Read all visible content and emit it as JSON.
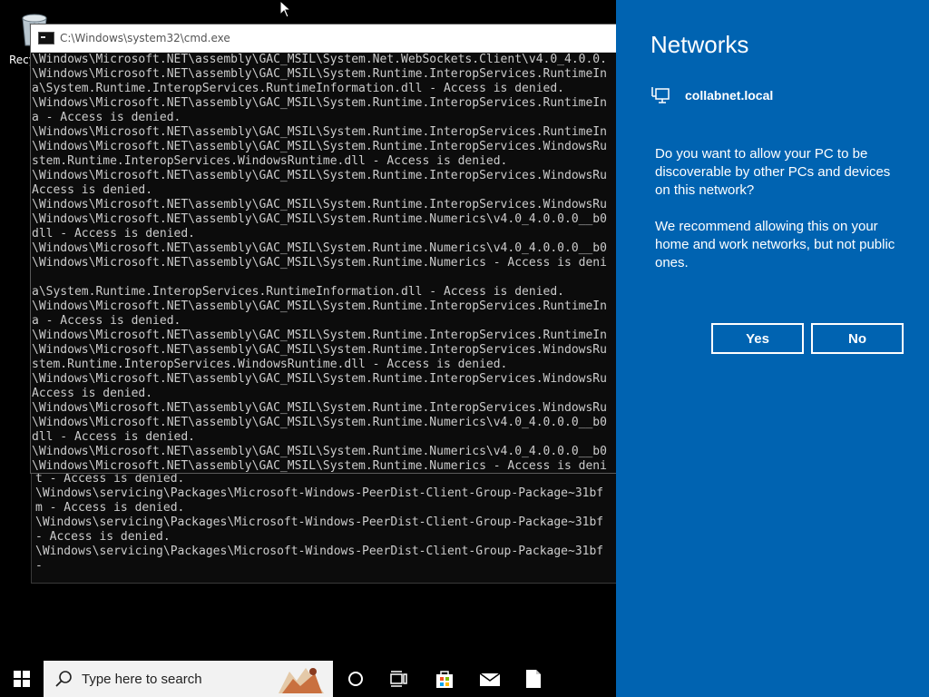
{
  "desktop": {
    "recycle_bin_label": "Recy"
  },
  "cmd_window": {
    "title": "C:\\Windows\\system32\\cmd.exe",
    "lines": [
      "\\Windows\\Microsoft.NET\\assembly\\GAC_MSIL\\System.Net.WebSockets.Client\\v4.0_4.0.0.",
      "\\Windows\\Microsoft.NET\\assembly\\GAC_MSIL\\System.Runtime.InteropServices.RuntimeIn",
      "a\\System.Runtime.InteropServices.RuntimeInformation.dll - Access is denied.",
      "\\Windows\\Microsoft.NET\\assembly\\GAC_MSIL\\System.Runtime.InteropServices.RuntimeIn",
      "a - Access is denied.",
      "\\Windows\\Microsoft.NET\\assembly\\GAC_MSIL\\System.Runtime.InteropServices.RuntimeIn",
      "\\Windows\\Microsoft.NET\\assembly\\GAC_MSIL\\System.Runtime.InteropServices.WindowsRu",
      "stem.Runtime.InteropServices.WindowsRuntime.dll - Access is denied.",
      "\\Windows\\Microsoft.NET\\assembly\\GAC_MSIL\\System.Runtime.InteropServices.WindowsRu",
      "Access is denied.",
      "\\Windows\\Microsoft.NET\\assembly\\GAC_MSIL\\System.Runtime.InteropServices.WindowsRu",
      "\\Windows\\Microsoft.NET\\assembly\\GAC_MSIL\\System.Runtime.Numerics\\v4.0_4.0.0.0__b0",
      "dll - Access is denied.",
      "\\Windows\\Microsoft.NET\\assembly\\GAC_MSIL\\System.Runtime.Numerics\\v4.0_4.0.0.0__b0",
      "\\Windows\\Microsoft.NET\\assembly\\GAC_MSIL\\System.Runtime.Numerics - Access is deni",
      "",
      "a\\System.Runtime.InteropServices.RuntimeInformation.dll - Access is denied.",
      "\\Windows\\Microsoft.NET\\assembly\\GAC_MSIL\\System.Runtime.InteropServices.RuntimeIn",
      "a - Access is denied.",
      "\\Windows\\Microsoft.NET\\assembly\\GAC_MSIL\\System.Runtime.InteropServices.RuntimeIn",
      "\\Windows\\Microsoft.NET\\assembly\\GAC_MSIL\\System.Runtime.InteropServices.WindowsRu",
      "stem.Runtime.InteropServices.WindowsRuntime.dll - Access is denied.",
      "\\Windows\\Microsoft.NET\\assembly\\GAC_MSIL\\System.Runtime.InteropServices.WindowsRu",
      "Access is denied.",
      "\\Windows\\Microsoft.NET\\assembly\\GAC_MSIL\\System.Runtime.InteropServices.WindowsRu",
      "\\Windows\\Microsoft.NET\\assembly\\GAC_MSIL\\System.Runtime.Numerics\\v4.0_4.0.0.0__b0",
      "dll - Access is denied.",
      "\\Windows\\Microsoft.NET\\assembly\\GAC_MSIL\\System.Runtime.Numerics\\v4.0_4.0.0.0__b0",
      "\\Windows\\Microsoft.NET\\assembly\\GAC_MSIL\\System.Runtime.Numerics - Access is deni"
    ]
  },
  "cmd_back": {
    "lines": [
      "t - Access is denied.",
      "\\Windows\\servicing\\Packages\\Microsoft-Windows-PeerDist-Client-Group-Package~31bf",
      "m - Access is denied.",
      "\\Windows\\servicing\\Packages\\Microsoft-Windows-PeerDist-Client-Group-Package~31bf",
      "- Access is denied.",
      "\\Windows\\servicing\\Packages\\Microsoft-Windows-PeerDist-Client-Group-Package~31bf",
      "-"
    ]
  },
  "network_panel": {
    "title": "Networks",
    "network_name": "collabnet.local",
    "question": "Do you want to allow your PC to be discoverable by other PCs and devices on this network?",
    "recommendation": "We recommend allowing this on your home and work networks, but not public ones.",
    "yes_label": "Yes",
    "no_label": "No",
    "bg_color": "#0063b1"
  },
  "taskbar": {
    "search_placeholder": "Type here to search",
    "icons": [
      "windows-start-icon",
      "cortana-icon",
      "task-view-icon",
      "store-icon",
      "mail-icon",
      "file-icon"
    ]
  }
}
